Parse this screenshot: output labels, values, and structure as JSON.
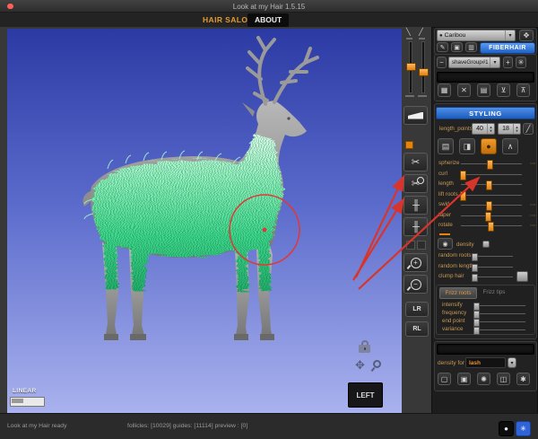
{
  "window": {
    "title": "Look at my Hair 1.5.15"
  },
  "tabs": {
    "hair_saloon": "HAIR SALOON",
    "about": "ABOUT"
  },
  "colors": {
    "accent_orange": "#e8820c",
    "header_blue": "#2b72d9",
    "annotation_red": "#d7352b",
    "fur_green": "#57e6a0"
  },
  "viewport": {
    "falloff_label": "LINEAR",
    "view_label": "LEFT"
  },
  "toolbar": {
    "lr_label": "LR",
    "rl_label": "RL",
    "sliders": [
      {
        "pos": 46
      },
      {
        "pos": 58
      }
    ]
  },
  "panel": {
    "figure_dropdown": "Caribou",
    "fiberhair_button": "FIBERHAIR",
    "group_dropdown": "shaveGroup#1",
    "styling": {
      "header": "STYLING",
      "length_points_label": "length_points",
      "points1": "40",
      "points2": "18",
      "sliders": [
        {
          "label": "spherize",
          "pos": 47
        },
        {
          "label": "curl",
          "pos": 3
        },
        {
          "label": "length",
          "pos": 46
        },
        {
          "label": "lift roots",
          "pos": 3
        },
        {
          "label": "swirl",
          "pos": 46
        },
        {
          "label": "taper",
          "pos": 44
        },
        {
          "label": "rotate",
          "pos": 48
        }
      ],
      "density_label": "density",
      "extra_sliders": [
        {
          "label": "random roots",
          "pos": 2
        },
        {
          "label": "random length",
          "pos": 2
        },
        {
          "label": "clump hair",
          "pos": 2
        }
      ],
      "frizz": {
        "tab_roots": "Frizz roots",
        "tab_tips": "Frizz tips",
        "sliders": [
          {
            "label": "intensify",
            "pos": 2
          },
          {
            "label": "frequency",
            "pos": 2
          },
          {
            "label": "end point",
            "pos": 2
          },
          {
            "label": "variance",
            "pos": 2
          }
        ]
      }
    },
    "density_for_label": "density for",
    "density_for_value": "lash"
  },
  "status": {
    "ready": "Look at my Hair ready",
    "counts": "follicles: [10029]  guides: [11114]  preview : [0]"
  },
  "icons": {
    "brush_left": "╲",
    "brush_right": "╱",
    "scissors": "✂",
    "circle": "○",
    "comb": "╫",
    "zoom_plus": "+",
    "zoom_minus": "−",
    "figure": "●",
    "frame": "✥",
    "pen": "✎",
    "image": "▣",
    "disk": "▥",
    "minus": "−",
    "plus": "+",
    "gear": "✳",
    "dd_arrow": "▾",
    "grid": "▦",
    "cross": "✕",
    "page": "▤",
    "pose_a": "⊻",
    "pose_b": "⊼",
    "up": "▲",
    "down": "▼",
    "slash": "╱",
    "tool_grid": "▤",
    "tool_half": "◨",
    "tool_dot": "●",
    "tool_legs": "∧",
    "dots": "⋯",
    "eye": "◉",
    "d1": "▢",
    "d2": "▣",
    "d3": "✺",
    "d4": "◫",
    "d5": "✱",
    "rec": "●",
    "gear2": "✳",
    "move": "✥"
  }
}
